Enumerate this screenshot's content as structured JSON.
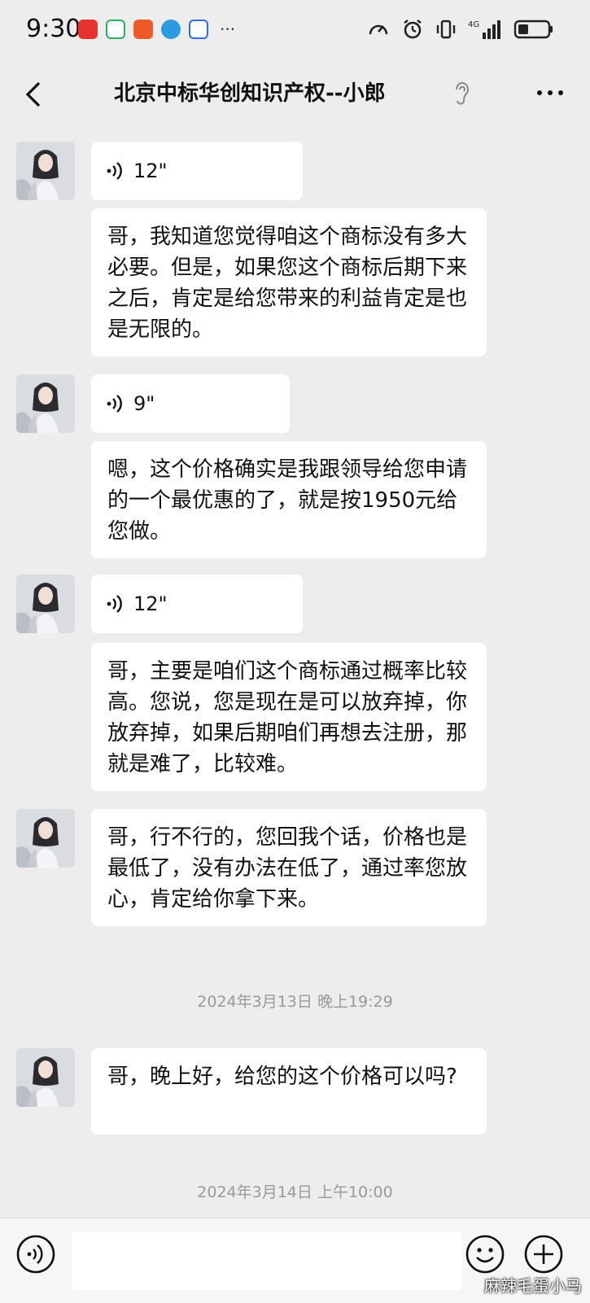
{
  "status_bar": {
    "time": "9:30",
    "notification_icons": [
      "app-icon",
      "chat-icon",
      "shop-icon",
      "browser-icon",
      "baidu-icon"
    ],
    "more": "···",
    "network": "4G"
  },
  "header": {
    "title": "北京中标华创知识产权--小郎",
    "back_icon": "chevron-left-icon",
    "ear_icon": "ear-icon",
    "more_icon": "more-dots-icon"
  },
  "messages": [
    {
      "type": "voice",
      "duration": "12\""
    },
    {
      "type": "text",
      "text": "哥，我知道您觉得咱这个商标没有多大必要。但是，如果您这个商标后期下来之后，肯定是给您带来的利益肯定是也是无限的。"
    },
    {
      "type": "voice",
      "duration": "9\""
    },
    {
      "type": "text",
      "text": "嗯，这个价格确实是我跟领导给您申请的一个最优惠的了，就是按1950元给您做。"
    },
    {
      "type": "voice",
      "duration": "12\""
    },
    {
      "type": "text",
      "text": "哥，主要是咱们这个商标通过概率比较高。您说，您是现在是可以放弃掉，你放弃掉，如果后期咱们再想去注册，那就是难了，比较难。"
    },
    {
      "type": "text",
      "text": "哥，行不行的，您回我个话，价格也是最低了，没有办法在低了，通过率您放心，肯定给你拿下来。"
    },
    {
      "type": "text",
      "text": "哥，晚上好，给您的这个价格可以吗?"
    }
  ],
  "timestamps": [
    "2024年3月13日 晚上19:29",
    "2024年3月14日 上午10:00"
  ],
  "input_bar": {
    "voice_icon": "voice-icon",
    "emoji_icon": "emoji-icon",
    "plus_icon": "plus-icon",
    "value": ""
  },
  "watermark": "麻辣毛蛋小马",
  "colors": {
    "background": "#ededed",
    "bubble": "#ffffff",
    "timestamp": "#999999"
  }
}
